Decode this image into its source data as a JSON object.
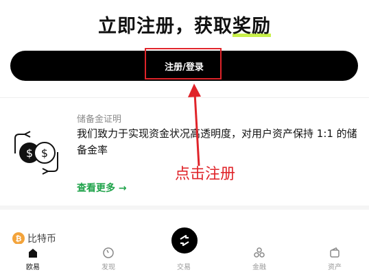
{
  "hero": {
    "title_main": "立即注册，获取",
    "title_highlight": "奖励"
  },
  "register_button": {
    "label": "注册/登录"
  },
  "reserve_card": {
    "label": "储备金证明",
    "description": "我们致力于实现资金状况高透明度，对用户资产保持 1:1 的储备金率",
    "link_text": "查看更多",
    "link_arrow": "→",
    "icon": "dollar-coins-exchange-icon"
  },
  "annotation": {
    "text": "点击注册",
    "color": "#e0242a"
  },
  "coin_preview": {
    "icon_glyph": "₿",
    "name": "比特币"
  },
  "tab_bar": {
    "tabs": [
      {
        "label": "欧易",
        "icon": "home-icon",
        "active": true
      },
      {
        "label": "发现",
        "icon": "compass-icon",
        "active": false
      },
      {
        "label": "交易",
        "icon": "swap-icon",
        "active": false
      },
      {
        "label": "金融",
        "icon": "finance-icon",
        "active": false
      },
      {
        "label": "资产",
        "icon": "wallet-icon",
        "active": false
      }
    ]
  },
  "colors": {
    "primary": "#000000",
    "highlight": "#c8f04a",
    "link_green": "#1fa34a",
    "annotation_red": "#e0242a",
    "bitcoin_orange": "#f3a33a"
  }
}
